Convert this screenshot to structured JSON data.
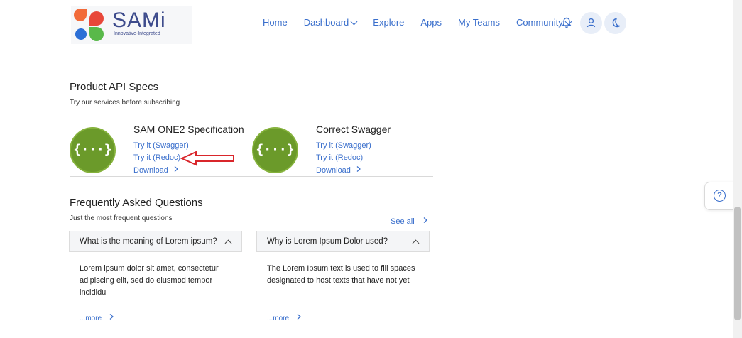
{
  "brand": {
    "name": "SAMi",
    "tagline": "Innovative-Integrated"
  },
  "nav": {
    "home": "Home",
    "dashboard": "Dashboard",
    "explore": "Explore",
    "apps": "Apps",
    "my_teams": "My Teams",
    "community": "Community"
  },
  "product_specs": {
    "title": "Product API Specs",
    "subtitle": "Try our services before subscribing",
    "logo_glyph": "{···}",
    "apis": [
      {
        "name": "SAM ONE2 Specification",
        "swagger": "Try it (Swagger)",
        "redoc": "Try it (Redoc)",
        "download": "Download"
      },
      {
        "name": "Correct Swagger",
        "swagger": "Try it (Swagger)",
        "redoc": "Try it (Redoc)",
        "download": "Download"
      }
    ]
  },
  "faq": {
    "title": "Frequently Asked Questions",
    "subtitle": "Just the most frequent questions",
    "see_all": "See all",
    "items": [
      {
        "question": "What is the meaning of Lorem ipsum?",
        "answer": "Lorem ipsum dolor sit amet, consectetur adipiscing elit, sed do eiusmod tempor incididu",
        "more": "...more"
      },
      {
        "question": "Why is Lorem Ipsum Dolor used?",
        "answer": "The Lorem Ipsum text is used to fill spaces designated to host texts that have not yet",
        "more": "...more"
      }
    ]
  },
  "help": {
    "glyph": "?"
  },
  "colors": {
    "link": "#3a6fcc",
    "brand": "#3d4b8c",
    "api_logo": "#6b9a2a",
    "annotation_arrow": "#d9262b"
  }
}
